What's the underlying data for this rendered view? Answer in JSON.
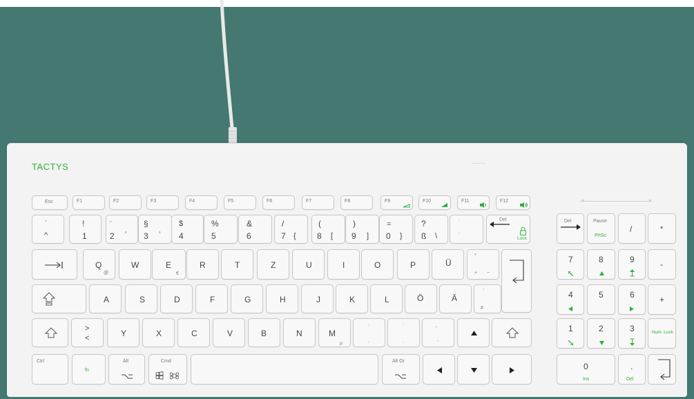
{
  "brand": "TACTYS",
  "colors": {
    "background": "#447871",
    "keyboard": "#f3f3f3",
    "accent": "#2fae3c"
  },
  "fn_row": [
    {
      "id": "esc",
      "label": "Esc"
    },
    {
      "id": "f1",
      "label": "F1"
    },
    {
      "id": "f2",
      "label": "F2"
    },
    {
      "id": "f3",
      "label": "F3"
    },
    {
      "id": "f4",
      "label": "F4"
    },
    {
      "id": "f5",
      "label": "F5"
    },
    {
      "id": "f6",
      "label": "F6"
    },
    {
      "id": "f7",
      "label": "F7"
    },
    {
      "id": "f8",
      "label": "F8"
    },
    {
      "id": "f9",
      "label": "F9"
    },
    {
      "id": "f10",
      "label": "F10"
    },
    {
      "id": "f11",
      "label": "F11"
    },
    {
      "id": "f12",
      "label": "F12"
    }
  ],
  "number_row": [
    {
      "id": "circumflex",
      "top": "°",
      "bottom": "^"
    },
    {
      "id": "1",
      "top": "!",
      "bottom": "1"
    },
    {
      "id": "2",
      "top": "\"",
      "bottom": "2",
      "alt": "²"
    },
    {
      "id": "3",
      "top": "§",
      "bottom": "3",
      "alt": "³"
    },
    {
      "id": "4",
      "top": "$",
      "bottom": "4"
    },
    {
      "id": "5",
      "top": "%",
      "bottom": "5"
    },
    {
      "id": "6",
      "top": "&",
      "bottom": "6"
    },
    {
      "id": "7",
      "top": "/",
      "bottom": "7",
      "alt": "{"
    },
    {
      "id": "8",
      "top": "(",
      "bottom": "8",
      "alt": "["
    },
    {
      "id": "9",
      "top": ")",
      "bottom": "9",
      "alt": "]"
    },
    {
      "id": "0",
      "top": "=",
      "bottom": "0",
      "alt": "}"
    },
    {
      "id": "sz",
      "top": "?",
      "bottom": "ß",
      "alt": "\\"
    },
    {
      "id": "acute",
      "top": "`",
      "bottom": "´"
    }
  ],
  "backspace": {
    "label": "Del",
    "lock": "Lock"
  },
  "qwertz_row": [
    "Q",
    "W",
    "E",
    "R",
    "T",
    "Z",
    "U",
    "I",
    "O",
    "P",
    "Ü"
  ],
  "q_alt": "@",
  "e_alt": "€",
  "plus_key": {
    "top": "*",
    "bottom": "+",
    "alt": "~"
  },
  "home_row": [
    "A",
    "S",
    "D",
    "F",
    "G",
    "H",
    "J",
    "K",
    "L",
    "Ö",
    "Ä"
  ],
  "hash_key": {
    "top": "'",
    "bottom": "#"
  },
  "bottom_row": [
    {
      "id": "angle",
      "top": ">",
      "bottom": "<"
    },
    {
      "id": "y",
      "label": "Y"
    },
    {
      "id": "x",
      "label": "X"
    },
    {
      "id": "c",
      "label": "C"
    },
    {
      "id": "v",
      "label": "V"
    },
    {
      "id": "b",
      "label": "B"
    },
    {
      "id": "n",
      "label": "N"
    },
    {
      "id": "m",
      "label": "M",
      "alt": "µ"
    },
    {
      "id": "comma",
      "top": ";",
      "bottom": ","
    },
    {
      "id": "period",
      "top": ":",
      "bottom": "."
    },
    {
      "id": "minus",
      "top": "_",
      "bottom": "-"
    }
  ],
  "mod_row": {
    "ctrl": "Ctrl",
    "fn": "fn",
    "alt": "Alt",
    "cmd": "Cmd",
    "altgr": "Alt Gr"
  },
  "numpad": {
    "del": "Del",
    "pause": "Pause",
    "prtsc": "PrtSc",
    "slash": "/",
    "star": "*",
    "minus": "-",
    "plus": "+",
    "numlock": "Num. Lock",
    "ins": "Ins",
    "numdel": "Del",
    "zero": "0",
    "dot": ".",
    "digits": [
      "7",
      "8",
      "9",
      "4",
      "5",
      "6",
      "1",
      "2",
      "3"
    ]
  }
}
